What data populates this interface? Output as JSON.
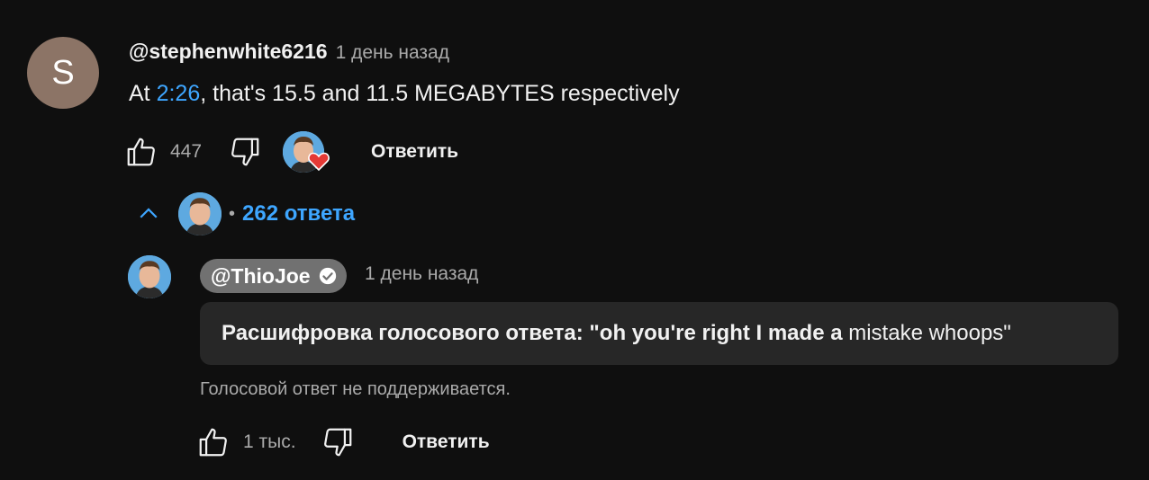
{
  "comment": {
    "avatar_letter": "S",
    "author": "@stephenwhite6216",
    "time": "1 день назад",
    "text_prefix": "At ",
    "timestamp_link": "2:26",
    "text_suffix": ", that's 15.5 and 11.5 MEGABYTES respectively",
    "like_count": "447",
    "reply_label": "Ответить",
    "creator_heart": "heart-icon"
  },
  "replies": {
    "count_label": "262 ответа",
    "separator": "•",
    "expanded": true
  },
  "reply": {
    "author": "@ThioJoe",
    "verified": true,
    "time": "1 день назад",
    "transcript_bold": "Расшифровка голосового ответа: \"oh you're right I made a",
    "transcript_normal": " mistake whoops\"",
    "unsupported_note": "Голосовой ответ не поддерживается.",
    "like_count": "1 тыс.",
    "reply_label": "Ответить"
  },
  "colors": {
    "background": "#0f0f0f",
    "link": "#3ea6ff",
    "secondary_text": "#aaaaaa",
    "heart": "#e53935"
  }
}
